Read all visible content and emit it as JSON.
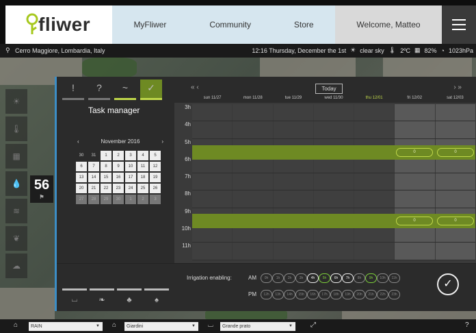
{
  "header": {
    "logo_text": "fliwer",
    "nav": [
      "MyFliwer",
      "Community",
      "Store"
    ],
    "welcome": "Welcome,  Matteo"
  },
  "locbar": {
    "location": "Cerro Maggiore, Lombardia, Italy",
    "datetime": "12:16  Thursday, December the 1st",
    "weather": "clear sky",
    "temp": "2ºC",
    "humidity": "82%",
    "pressure": "1023hPa"
  },
  "sidebar": {
    "temperature": "56"
  },
  "panel": {
    "tabs": [
      "!",
      "?",
      "~",
      "✓"
    ],
    "title": "Task manager",
    "calendar": {
      "month": "November 2016",
      "days": [
        [
          "30",
          "31",
          "1",
          "2",
          "3",
          "4",
          "5"
        ],
        [
          "6",
          "7",
          "8",
          "9",
          "10",
          "11",
          "12"
        ],
        [
          "13",
          "14",
          "15",
          "16",
          "17",
          "18",
          "19"
        ],
        [
          "20",
          "21",
          "22",
          "23",
          "24",
          "25",
          "26"
        ],
        [
          "27",
          "28",
          "29",
          "30",
          "1",
          "2",
          "3"
        ]
      ]
    },
    "schedule": {
      "today_label": "Today",
      "days": [
        "sun 11/27",
        "mon 11/28",
        "tue 11/29",
        "wed 11/30",
        "thu 12/01",
        "fri 12/02",
        "sat 12/03"
      ],
      "hours": [
        "3h",
        "4h",
        "5h",
        "6h",
        "7h",
        "8h",
        "9h",
        "10h",
        "11h"
      ],
      "pill_label": "0"
    },
    "irrigation": {
      "label": "Irrigation enabling:",
      "am_label": "AM",
      "pm_label": "PM",
      "am_slots": [
        "0h",
        "1h",
        "2h",
        "3h",
        "4h",
        "5h",
        "6h",
        "7h",
        "8h",
        "9h",
        "10h",
        "11h"
      ],
      "pm_slots": [
        "12h",
        "13h",
        "14h",
        "15h",
        "16h",
        "17h",
        "18h",
        "19h",
        "20h",
        "21h",
        "22h",
        "23h"
      ]
    }
  },
  "footer": {
    "select1": "RAIN",
    "select2": "Giardini",
    "select3": "Grande prato"
  }
}
